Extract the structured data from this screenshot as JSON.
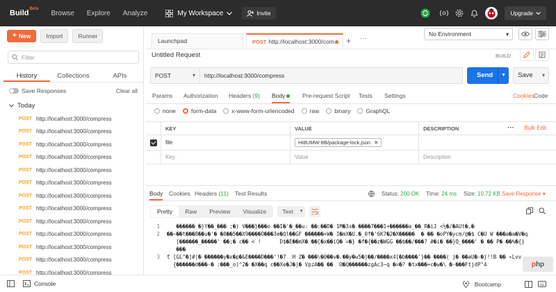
{
  "topbar": {
    "brand": "Build",
    "brand_badge": "Beta",
    "nav": [
      "Browse",
      "Explore",
      "Analyze"
    ],
    "workspace": "My Workspace",
    "invite": "Invite",
    "upgrade": "Upgrade"
  },
  "sidebar": {
    "new_label": "New",
    "import_label": "Import",
    "runner_label": "Runner",
    "filter_placeholder": "Filter",
    "tabs": [
      "History",
      "Collections",
      "APIs"
    ],
    "save_responses": "Save Responses",
    "clear_all": "Clear all",
    "group": "Today",
    "history": [
      {
        "method": "POST",
        "url": "http://localhost:3000/compress"
      },
      {
        "method": "POST",
        "url": "http://localhost:3000/compress"
      },
      {
        "method": "POST",
        "url": "http://localhost:3000/compress"
      },
      {
        "method": "POST",
        "url": "http://localhost:3000/compress"
      },
      {
        "method": "POST",
        "url": "http://localhost:3000/compress"
      },
      {
        "method": "POST",
        "url": "http://localhost:3000/compress"
      },
      {
        "method": "POST",
        "url": "http://localhost:3000/compress"
      },
      {
        "method": "POST",
        "url": "http://localhost:3000/compress"
      },
      {
        "method": "POST",
        "url": "http://localhost:3000/compress"
      },
      {
        "method": "POST",
        "url": "http://localhost:3000/compress"
      },
      {
        "method": "POST",
        "url": "http://localhost:3000/compress"
      },
      {
        "method": "POST",
        "url": "http://localhost:3000/compress"
      },
      {
        "method": "POST",
        "url": "http://localhost:3000/compress"
      }
    ]
  },
  "tabs": {
    "launchpad": "Launchpad",
    "active_method": "POST",
    "active_url": "http://localhost:3000/com..."
  },
  "env": {
    "selected": "No Environment"
  },
  "request": {
    "title": "Untitled Request",
    "build_label": "BUILD",
    "method": "POST",
    "url": "http://localhost:3000/compress",
    "send": "Send",
    "save": "Save",
    "tabs": {
      "params": "Params",
      "authorization": "Authorization",
      "headers": "Headers",
      "headers_count": "(9)",
      "body": "Body",
      "prerequest": "Pre-request Script",
      "tests": "Tests",
      "settings": "Settings"
    },
    "cookies": "Cookies",
    "code": "Code",
    "body_types": [
      "none",
      "form-data",
      "x-www-form-urlencoded",
      "raw",
      "binary",
      "GraphQL"
    ],
    "table": {
      "headers": [
        "KEY",
        "VALUE",
        "DESCRIPTION"
      ],
      "bulk_edit": "Bulk Edit",
      "row_key": "file",
      "row_value": "HI8UMW-8B/package-lock.json",
      "key_placeholder": "Key",
      "value_placeholder": "Value",
      "desc_placeholder": "Description"
    }
  },
  "response": {
    "tabs": {
      "body": "Body",
      "cookies": "Cookies",
      "headers": "Headers",
      "headers_count": "(11)",
      "tests": "Test Results"
    },
    "status_label": "Status:",
    "status": "200 OK",
    "time_label": "Time:",
    "time": "24 ms",
    "size_label": "Size:",
    "size": "10.72 KB",
    "save": "Save Response",
    "views": [
      "Pretty",
      "Raw",
      "Preview",
      "Visualize"
    ],
    "format": "Text",
    "lines": [
      {
        "n": "1",
        "text": "   ������ �}Y��_��� ;�) V���}���o ��I�'�_��u: ��:��D� 1M�3s� ����7���1+������a_��_R�iJ <½�/�AUt�,�"
      },
      {
        "n": "2",
        "text": "��~��t���8��u�'� �8��5��X9����Ò���3e�Ql��GF ������+W� I�mX�U.�_0f�'6K7�2�X�����  � �� �oPY�ycm/@�$ C�U W ���a�a�V�q"
      },
      {
        "n": "",
        "text": "   [������_�����' ��;� c�� < !      D$�E��mX� ��[�x��iQ� =�} �f�{��z�WGG ��$��/���? #�i� ��}Q_����' � �� P� ��%�{}"
      },
      {
        "n": "",
        "text": "   ���"
      },
      {
        "n": "3",
        "text": "ť [GL^�]#|� ������y�x�p�&E����D���'!�7  H Z� ���\\�0��v�.��y�w5�j��/����x4[�b����'}�� ����( j� ��aU�-�j!!B �� ∗Lvv"
      },
      {
        "n": "",
        "text": "  {������d���-� :���_o)^2� �X��q c��Xe�J�|� VpzA�� ��  ₪�Q������zgAc3~q �=�? �tx���+c�w�\\ �-���FtjdP\"4"
      }
    ]
  },
  "footer": {
    "console": "Console",
    "bootcamp": "Bootcamp"
  },
  "watermark": {
    "p": "p",
    "rest": "hp"
  }
}
